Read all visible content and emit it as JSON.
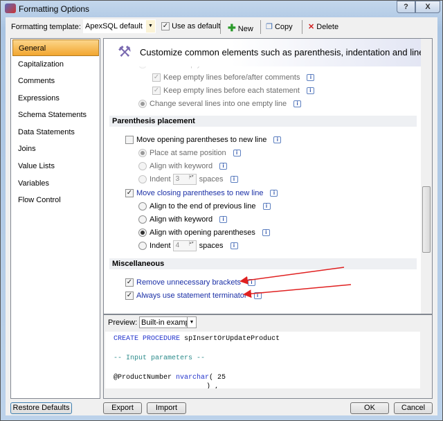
{
  "window": {
    "title": "Formatting Options",
    "help_label": "?",
    "close_label": "X"
  },
  "toolbar": {
    "template_label": "Formatting template:",
    "template_value": "ApexSQL default",
    "use_as_default_label": "Use as default",
    "use_as_default_checked": true,
    "new_label": "New",
    "copy_label": "Copy",
    "delete_label": "Delete"
  },
  "sidebar": {
    "items": [
      {
        "label": "General",
        "selected": true
      },
      {
        "label": "Capitalization"
      },
      {
        "label": "Comments"
      },
      {
        "label": "Expressions"
      },
      {
        "label": "Schema Statements"
      },
      {
        "label": "Data Statements"
      },
      {
        "label": "Joins"
      },
      {
        "label": "Value Lists"
      },
      {
        "label": "Variables"
      },
      {
        "label": "Flow Control"
      }
    ]
  },
  "header": {
    "description": "Customize common elements such as parenthesis, indentation and line formatting"
  },
  "options": {
    "remove_empty_lines": "Remove empty lines",
    "keep_before_after_comments": "Keep empty lines before/after comments",
    "keep_before_statement": "Keep empty lines before each statement",
    "change_several_lines": "Change several lines into one empty line",
    "paren_section": "Parenthesis placement",
    "move_opening": "Move opening parentheses to new line",
    "place_same": "Place at same position",
    "align_keyword_1": "Align with keyword",
    "indent_1": "Indent",
    "indent_1_value": "3",
    "spaces_1": "spaces",
    "move_closing": "Move closing parentheses to new line",
    "align_end": "Align to the end of previous line",
    "align_keyword_2": "Align with keyword",
    "align_opening": "Align with opening parentheses",
    "indent_2": "Indent",
    "indent_2_value": "4",
    "spaces_2": "spaces",
    "misc_section": "Miscellaneous",
    "remove_brackets": "Remove unnecessary brackets",
    "statement_terminator": "Always use statement terminator"
  },
  "preview": {
    "label": "Preview:",
    "value": "Built-in example",
    "code": [
      "CREATE",
      "PROCEDURE",
      "spInsertOrUpdateProduct",
      "-- Input parameters --",
      "@ProductNumber",
      "nvarchar",
      "( 25",
      ") ,"
    ]
  },
  "footer": {
    "restore_label": "Restore Defaults",
    "export_label": "Export",
    "import_label": "Import",
    "ok_label": "OK",
    "cancel_label": "Cancel"
  },
  "colors": {
    "annotation_arrow": "#e02020",
    "selected_nav": "#f2a630"
  }
}
